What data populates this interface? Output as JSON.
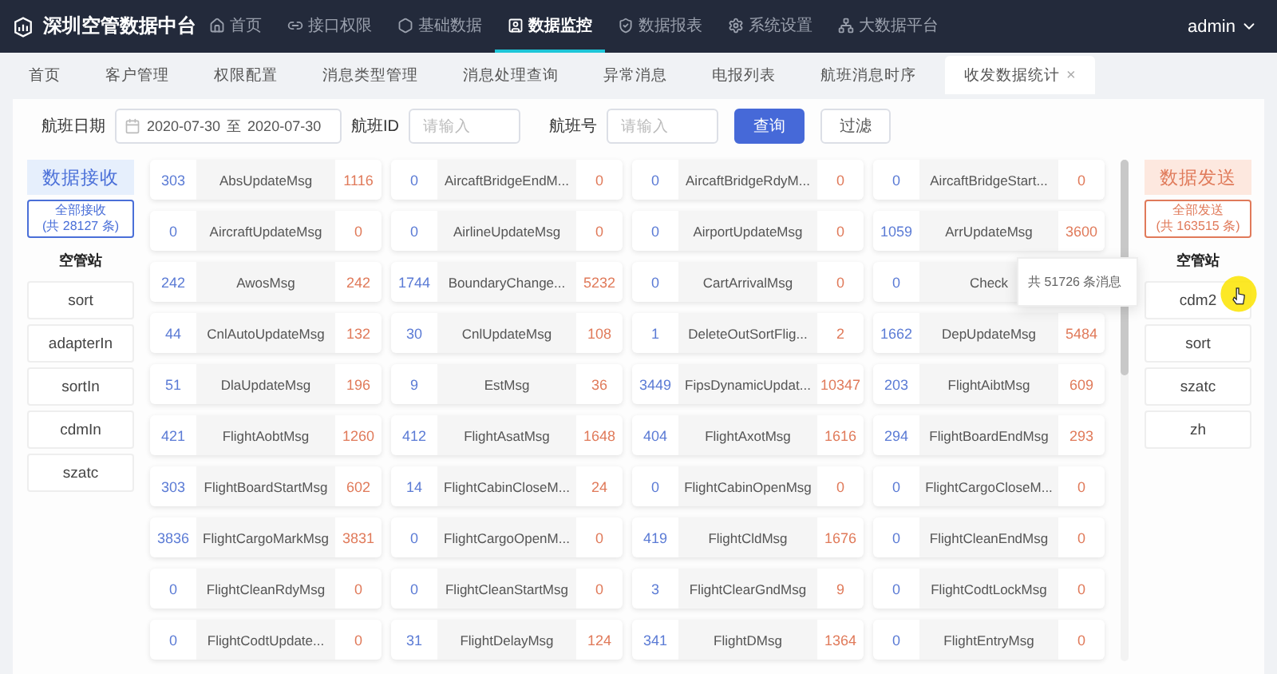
{
  "app": {
    "title": "深圳空管数据中台"
  },
  "nav": [
    {
      "label": "首页",
      "selected": false
    },
    {
      "label": "接口权限",
      "selected": false
    },
    {
      "label": "基础数据",
      "selected": false
    },
    {
      "label": "数据监控",
      "selected": true
    },
    {
      "label": "数据报表",
      "selected": false
    },
    {
      "label": "系统设置",
      "selected": false
    },
    {
      "label": "大数据平台",
      "selected": false
    }
  ],
  "user": "admin",
  "tabs": [
    {
      "label": "首页",
      "selected": false
    },
    {
      "label": "客户管理",
      "selected": false
    },
    {
      "label": "权限配置",
      "selected": false
    },
    {
      "label": "消息类型管理",
      "selected": false
    },
    {
      "label": "消息处理查询",
      "selected": false
    },
    {
      "label": "异常消息",
      "selected": false
    },
    {
      "label": "电报列表",
      "selected": false
    },
    {
      "label": "航班消息时序",
      "selected": false
    },
    {
      "label": "收发数据统计",
      "selected": true,
      "close": "×"
    }
  ],
  "filter": {
    "date_label": "航班日期",
    "date_from": "2020-07-30",
    "date_sep": "至",
    "date_to": "2020-07-30",
    "id_label": "航班ID",
    "id_placeholder": "请输入",
    "no_label": "航班号",
    "no_placeholder": "请输入",
    "query_button": "查询",
    "filter_button": "过滤"
  },
  "receive": {
    "title": "数据接收",
    "all_label": "全部接收",
    "all_count": "(共 28127 条)",
    "group_label": "空管站",
    "stations": [
      "sort",
      "adapterIn",
      "sortIn",
      "cdmIn",
      "szatc"
    ]
  },
  "send": {
    "title": "数据发送",
    "all_label": "全部发送",
    "all_count": "(共 163515 条)",
    "group_label": "空管站",
    "stations": [
      "cdm2",
      "sort",
      "szatc",
      "zh"
    ]
  },
  "stats": [
    [
      {
        "in": "303",
        "name": "AbsUpdateMsg",
        "out": "1116"
      },
      {
        "in": "0",
        "name": "AircaftBridgeEndM...",
        "out": "0"
      },
      {
        "in": "0",
        "name": "AircaftBridgeRdyM...",
        "out": "0"
      },
      {
        "in": "0",
        "name": "AircaftBridgeStart...",
        "out": "0"
      }
    ],
    [
      {
        "in": "0",
        "name": "AircraftUpdateMsg",
        "out": "0"
      },
      {
        "in": "0",
        "name": "AirlineUpdateMsg",
        "out": "0"
      },
      {
        "in": "0",
        "name": "AirportUpdateMsg",
        "out": "0"
      },
      {
        "in": "1059",
        "name": "ArrUpdateMsg",
        "out": "3600"
      }
    ],
    [
      {
        "in": "242",
        "name": "AwosMsg",
        "out": "242"
      },
      {
        "in": "1744",
        "name": "BoundaryChange...",
        "out": "5232"
      },
      {
        "in": "0",
        "name": "CartArrivalMsg",
        "out": "0"
      },
      {
        "in": "0",
        "name": "Check",
        "tooltip": "共 51726 条消息"
      }
    ],
    [
      {
        "in": "44",
        "name": "CnlAutoUpdateMsg",
        "out": "132"
      },
      {
        "in": "30",
        "name": "CnlUpdateMsg",
        "out": "108"
      },
      {
        "in": "1",
        "name": "DeleteOutSortFlig...",
        "out": "2"
      },
      {
        "in": "1662",
        "name": "DepUpdateMsg",
        "out": "5484"
      }
    ],
    [
      {
        "in": "51",
        "name": "DlaUpdateMsg",
        "out": "196"
      },
      {
        "in": "9",
        "name": "EstMsg",
        "out": "36"
      },
      {
        "in": "3449",
        "name": "FipsDynamicUpdat...",
        "out": "10347"
      },
      {
        "in": "203",
        "name": "FlightAibtMsg",
        "out": "609"
      }
    ],
    [
      {
        "in": "421",
        "name": "FlightAobtMsg",
        "out": "1260"
      },
      {
        "in": "412",
        "name": "FlightAsatMsg",
        "out": "1648"
      },
      {
        "in": "404",
        "name": "FlightAxotMsg",
        "out": "1616"
      },
      {
        "in": "294",
        "name": "FlightBoardEndMsg",
        "out": "293"
      }
    ],
    [
      {
        "in": "303",
        "name": "FlightBoardStartMsg",
        "out": "602"
      },
      {
        "in": "14",
        "name": "FlightCabinCloseM...",
        "out": "24"
      },
      {
        "in": "0",
        "name": "FlightCabinOpenMsg",
        "out": "0"
      },
      {
        "in": "0",
        "name": "FlightCargoCloseM...",
        "out": "0"
      }
    ],
    [
      {
        "in": "3836",
        "name": "FlightCargoMarkMsg",
        "out": "3831"
      },
      {
        "in": "0",
        "name": "FlightCargoOpenM...",
        "out": "0"
      },
      {
        "in": "419",
        "name": "FlightCldMsg",
        "out": "1676"
      },
      {
        "in": "0",
        "name": "FlightCleanEndMsg",
        "out": "0"
      }
    ],
    [
      {
        "in": "0",
        "name": "FlightCleanRdyMsg",
        "out": "0"
      },
      {
        "in": "0",
        "name": "FlightCleanStartMsg",
        "out": "0"
      },
      {
        "in": "3",
        "name": "FlightClearGndMsg",
        "out": "9"
      },
      {
        "in": "0",
        "name": "FlightCodtLockMsg",
        "out": "0"
      }
    ],
    [
      {
        "in": "0",
        "name": "FlightCodtUpdate...",
        "out": "0"
      },
      {
        "in": "31",
        "name": "FlightDelayMsg",
        "out": "124"
      },
      {
        "in": "341",
        "name": "FlightDMsg",
        "out": "1364"
      },
      {
        "in": "0",
        "name": "FlightEntryMsg",
        "out": "0"
      }
    ]
  ]
}
